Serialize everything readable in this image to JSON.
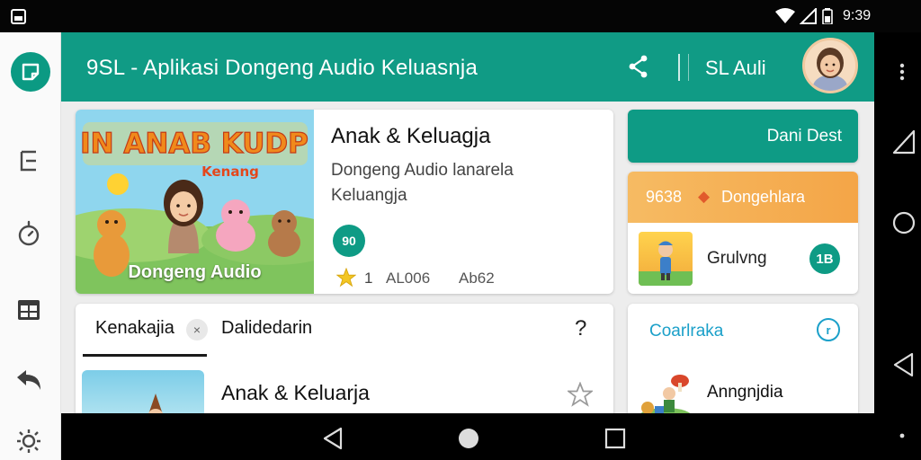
{
  "status_bar": {
    "time": "9:39"
  },
  "app_bar": {
    "title": "9SL - Aplikasi Dongeng Audio Keluasnja",
    "action_label": "SL Auli"
  },
  "featured": {
    "image_label": "Dongeng Audio",
    "title": "Anak & Keluagja",
    "subtitle": "Dongeng Audio lanarela Keluangja",
    "badge": "90",
    "rating": "1",
    "stat_1": "AL006",
    "stat_2": "Ab62"
  },
  "primary_button": {
    "label": "Dani Dest"
  },
  "promo": {
    "time": "9638",
    "arrow": "◆",
    "label": "Dongehlara",
    "item_label": "Grulvng",
    "count": "1B"
  },
  "list": {
    "tab_active": "Kenakajia",
    "tab_close": "×",
    "tab_inactive": "Dalidedarin",
    "help": "?",
    "item_title": "Anak & Keluarja"
  },
  "side_card": {
    "title": "Coarlraka",
    "icon_text": "r",
    "item_label": "Anngnjdia"
  },
  "colors": {
    "primary": "#109b85",
    "accent_orange": "#f4a547",
    "link_blue": "#1ba0c9"
  }
}
